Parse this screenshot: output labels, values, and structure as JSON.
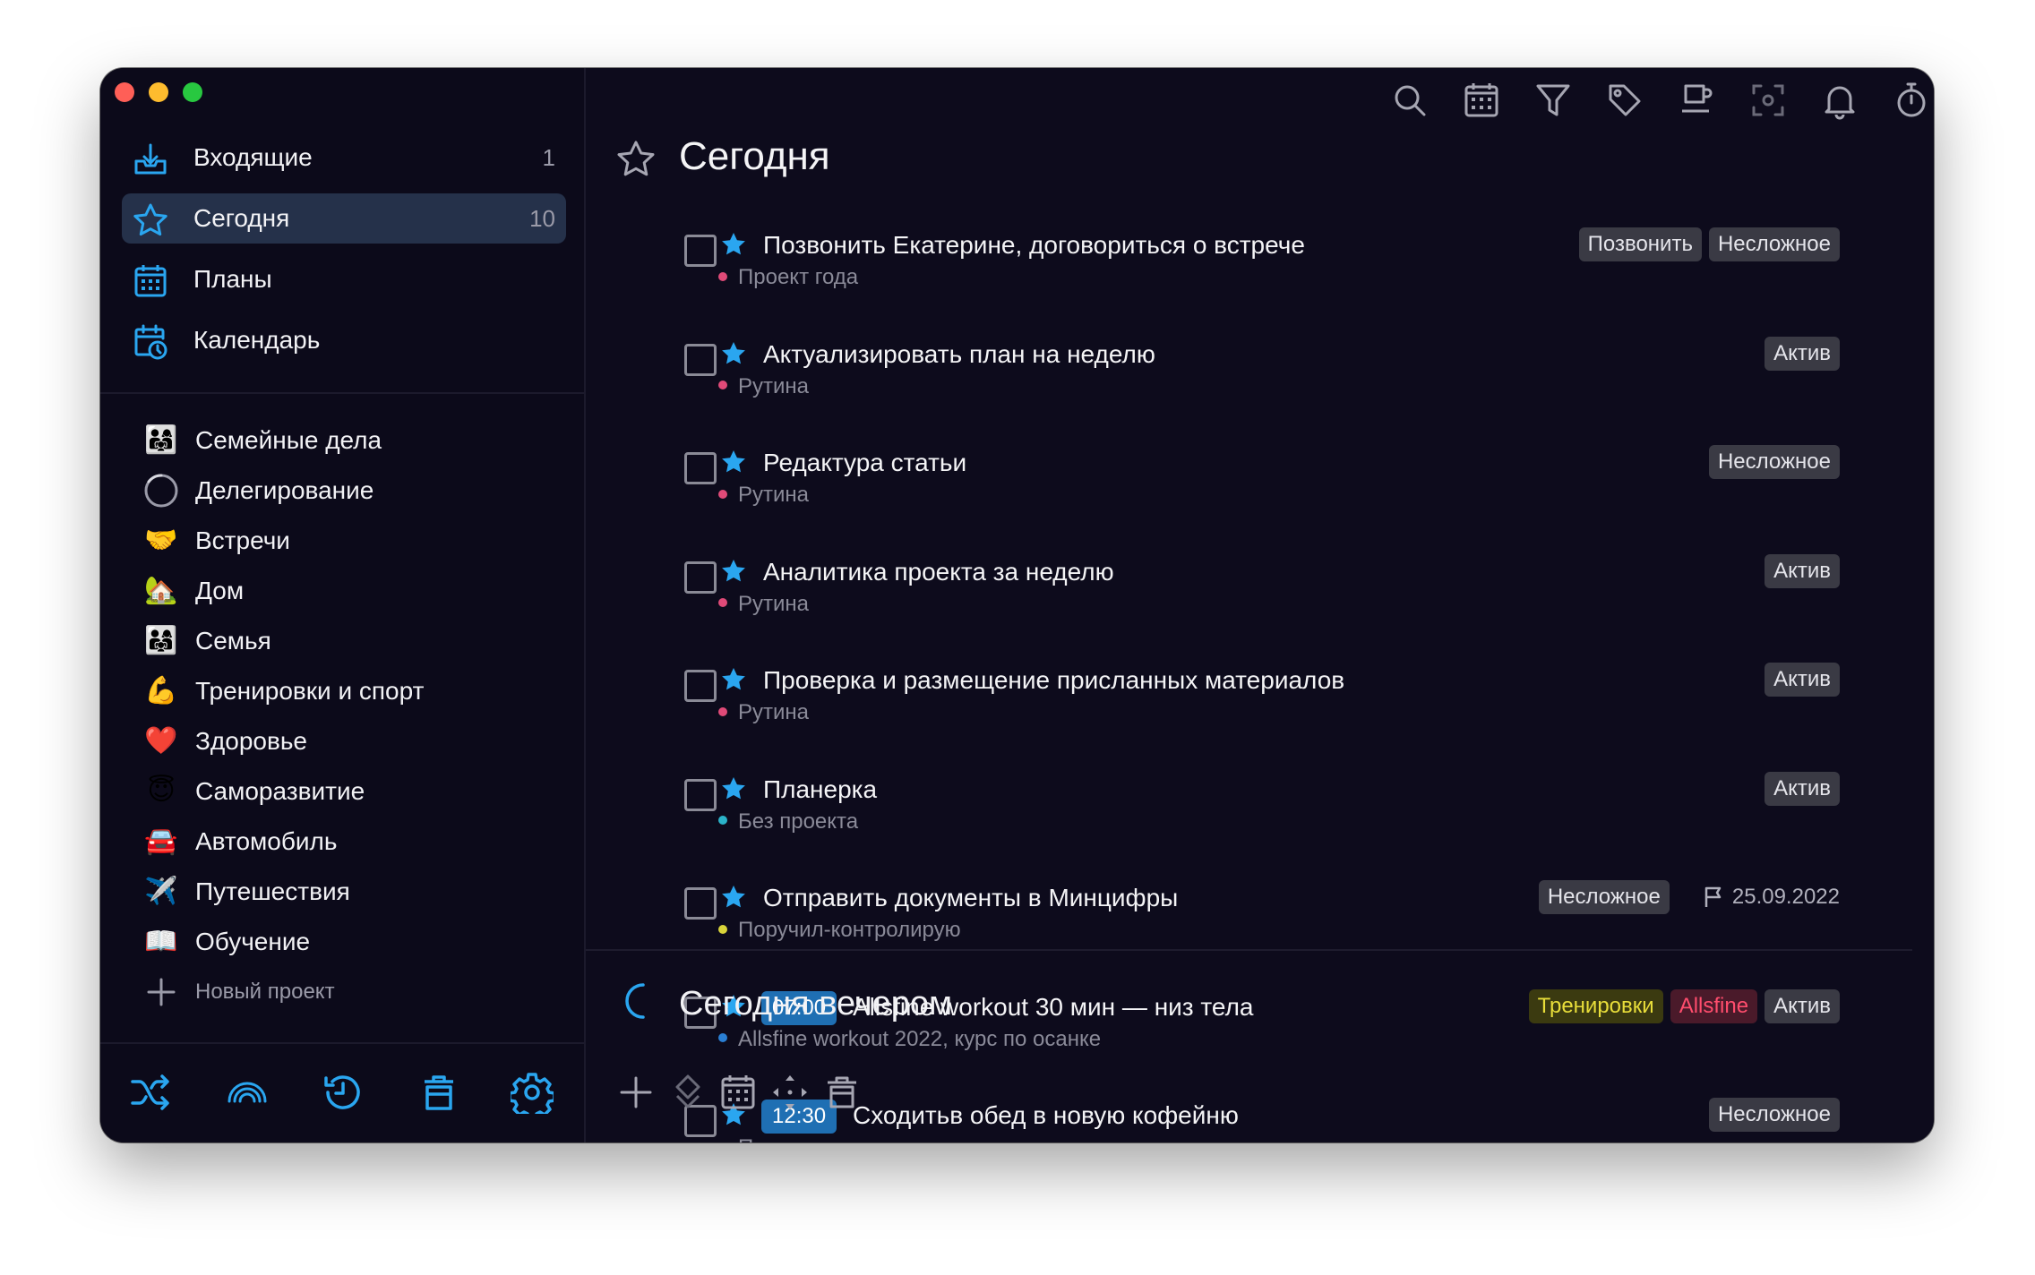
{
  "sidebar": {
    "nav": [
      {
        "label": "Входящие",
        "count": "1"
      },
      {
        "label": "Сегодня",
        "count": "10"
      },
      {
        "label": "Планы",
        "count": ""
      },
      {
        "label": "Календарь",
        "count": ""
      }
    ],
    "projects": [
      {
        "emoji": "👨‍👩‍👧",
        "label": "Семейные дела"
      },
      {
        "emoji": "",
        "label": "Делегирование"
      },
      {
        "emoji": "🤝",
        "label": "Встречи"
      },
      {
        "emoji": "🏡",
        "label": "Дом"
      },
      {
        "emoji": "👨‍👩‍👧",
        "label": "Семья"
      },
      {
        "emoji": "💪",
        "label": "Тренировки и спорт"
      },
      {
        "emoji": "❤️",
        "label": "Здоровье"
      },
      {
        "emoji": "😇",
        "label": "Саморазвитие"
      },
      {
        "emoji": "🚘",
        "label": "Автомобиль"
      },
      {
        "emoji": "✈️",
        "label": "Путешествия"
      },
      {
        "emoji": "📖",
        "label": "Обучение"
      }
    ],
    "new_project": "Новый проект"
  },
  "main": {
    "title": "Сегодня",
    "tasks": [
      {
        "time": "",
        "title": "Позвонить Екатерине, договориться о встрече",
        "project": "Проект года",
        "dot": "#e04a78",
        "tags": [
          {
            "label": "Позвонить",
            "style": ""
          },
          {
            "label": "Несложное",
            "style": ""
          }
        ],
        "due": ""
      },
      {
        "time": "",
        "title": "Актуализировать план на неделю",
        "project": "Рутина",
        "dot": "#e04a78",
        "tags": [
          {
            "label": "Актив",
            "style": ""
          }
        ],
        "due": ""
      },
      {
        "time": "",
        "title": "Редактура статьи",
        "project": "Рутина",
        "dot": "#e04a78",
        "tags": [
          {
            "label": "Несложное",
            "style": ""
          }
        ],
        "due": ""
      },
      {
        "time": "",
        "title": "Аналитика проекта за неделю",
        "project": "Рутина",
        "dot": "#e04a78",
        "tags": [
          {
            "label": "Актив",
            "style": ""
          }
        ],
        "due": ""
      },
      {
        "time": "",
        "title": "Проверка и размещение присланных материалов",
        "project": "Рутина",
        "dot": "#e04a78",
        "tags": [
          {
            "label": "Актив",
            "style": ""
          }
        ],
        "due": ""
      },
      {
        "time": "",
        "title": "Планерка",
        "project": "Без проекта",
        "dot": "#2bb3c9",
        "tags": [
          {
            "label": "Актив",
            "style": ""
          }
        ],
        "due": ""
      },
      {
        "time": "",
        "title": "Отправить документы в Минцифры",
        "project": "Поручил-контролирую",
        "dot": "#d9d43a",
        "tags": [
          {
            "label": "Несложное",
            "style": ""
          }
        ],
        "due": "25.09.2022"
      },
      {
        "time": "07:00",
        "title": "Allsfine workout 30 мин — низ тела",
        "project": "Allsfine workout 2022, курс по осанке",
        "dot": "#2a7fd4",
        "tags": [
          {
            "label": "Тренировки",
            "style": "yellow"
          },
          {
            "label": "Allsfine",
            "style": "pink"
          },
          {
            "label": "Актив",
            "style": ""
          }
        ],
        "due": ""
      },
      {
        "time": "12:30",
        "title": "Сходитьв обед в новую кофейню",
        "project": "Покупки",
        "dot": "#2bc99a",
        "tags": [
          {
            "label": "Несложное",
            "style": ""
          }
        ],
        "due": ""
      }
    ],
    "evening_title": "Сегодня вечером"
  },
  "colors": {
    "accent": "#2aa6f0",
    "window_bg": "#0d0b1c",
    "active_nav_bg": "#25314a",
    "tag_bg": "#3a3a44"
  },
  "icons": {
    "toolbar": [
      "search-icon",
      "calendar-grid-icon",
      "filter-icon",
      "tag-icon",
      "coffee-icon",
      "focus-icon",
      "bell-icon",
      "timer-icon",
      "copy-windows-icon"
    ],
    "sidebar_bottom": [
      "shuffle-icon",
      "rainbow-icon",
      "history-icon",
      "trash-icon",
      "gear-icon"
    ],
    "main_bottom": [
      "plus-icon",
      "move-layers-icon",
      "calendar-grid-icon",
      "move-arrows-icon",
      "trash-icon",
      "cloud-icon"
    ]
  }
}
